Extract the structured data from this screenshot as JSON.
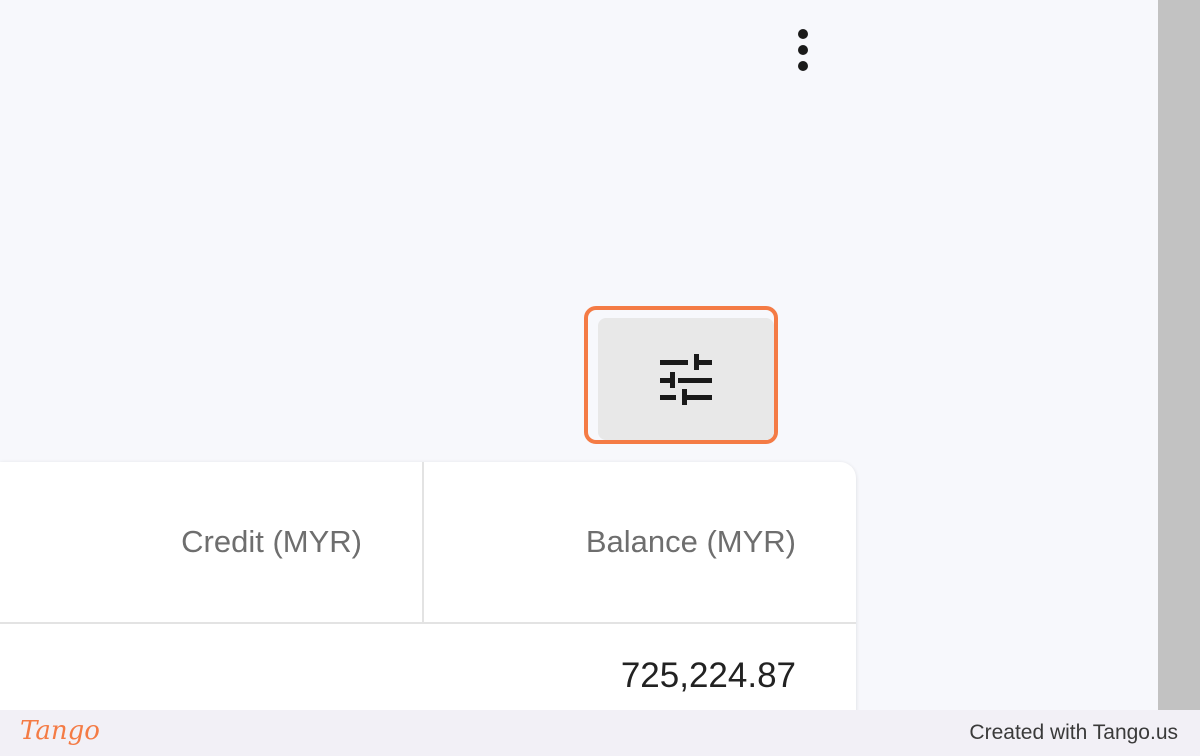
{
  "table": {
    "columns": [
      "Credit (MYR)",
      "Balance (MYR)"
    ],
    "rows": [
      {
        "credit": "",
        "balance": "725,224.87"
      }
    ]
  },
  "toolbar": {
    "more_icon": "more-vert-icon",
    "filter_icon": "tune-icon"
  },
  "footer": {
    "logo": "Tango",
    "credit": "Created with Tango.us"
  },
  "colors": {
    "highlight": "#f47b45",
    "background": "#f7f8fc",
    "button": "#e8e8e8"
  }
}
